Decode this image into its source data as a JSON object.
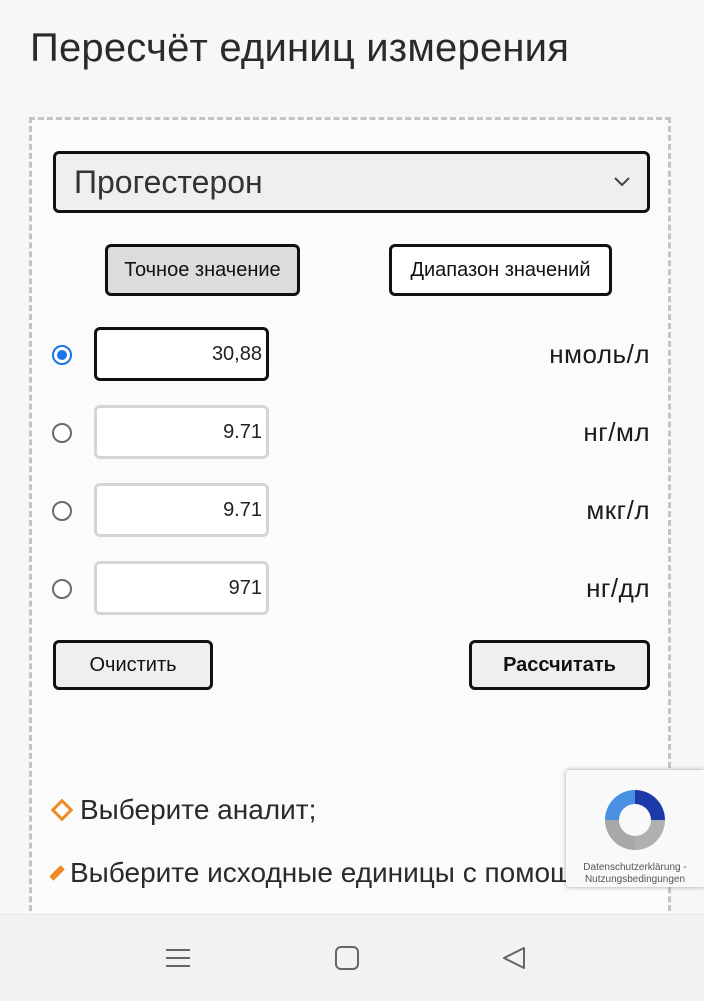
{
  "page": {
    "title": "Пересчёт единиц измерения"
  },
  "analyte_select": {
    "selected": "Прогестерон"
  },
  "mode_buttons": {
    "exact_label": "Точное значение",
    "range_label": "Диапазон значений"
  },
  "rows": [
    {
      "value": "30,88",
      "unit": "нмоль/л",
      "checked": true
    },
    {
      "value": "9.71",
      "unit": "нг/мл",
      "checked": false
    },
    {
      "value": "9.71",
      "unit": "мкг/л",
      "checked": false
    },
    {
      "value": "971",
      "unit": "нг/дл",
      "checked": false
    }
  ],
  "actions": {
    "clear_label": "Очистить",
    "calculate_label": "Рассчитать"
  },
  "instructions": [
    "Выберите аналит;",
    "Выберите исходные единицы с помощ"
  ],
  "recaptcha": {
    "links": "Datenschutzerklärung - Nutzungsbedingungen"
  },
  "colors": {
    "accent_radio": "#1a73e8",
    "bullet_orange": "#f08a24"
  },
  "icons": {
    "select_chevron": "chevron-down-icon",
    "nav_menu": "menu-icon",
    "nav_home": "home-square-icon",
    "nav_back": "back-triangle-icon"
  }
}
